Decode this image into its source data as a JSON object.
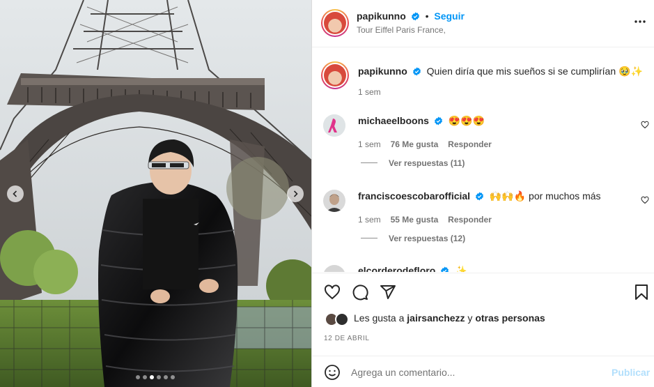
{
  "post": {
    "author": "papikunno",
    "follow_label": "Seguir",
    "location": "Tour Eiffel Paris France,",
    "more_icon": "more-options-icon",
    "media": {
      "slide_count": 6,
      "active_slide": 3
    }
  },
  "caption": {
    "author": "papikunno",
    "text": "Quien diría que mis sueños si se cumplirían 🥹✨",
    "time": "1 sem"
  },
  "comments": [
    {
      "author": "michaeelboons",
      "text": "😍😍😍",
      "time": "1 sem",
      "likes": "76 Me gusta",
      "reply_label": "Responder",
      "view_replies": "Ver respuestas (11)"
    },
    {
      "author": "franciscoescobarofficial",
      "text": "🙌🙌🔥 por muchos más",
      "time": "1 sem",
      "likes": "55 Me gusta",
      "reply_label": "Responder",
      "view_replies": "Ver respuestas (12)"
    },
    {
      "author": "elcorderodefloro",
      "text": "✨"
    }
  ],
  "likes_line": {
    "prefix": "Les gusta a ",
    "user": "jairsanchezz",
    "middle": " y ",
    "others": "otras personas"
  },
  "date": "12 DE ABRIL",
  "composer": {
    "placeholder": "Agrega un comentario...",
    "publish_label": "Publicar"
  },
  "colors": {
    "accent": "#0095f6",
    "verified": "#0095f6",
    "publish_disabled": "#b2dffc"
  }
}
